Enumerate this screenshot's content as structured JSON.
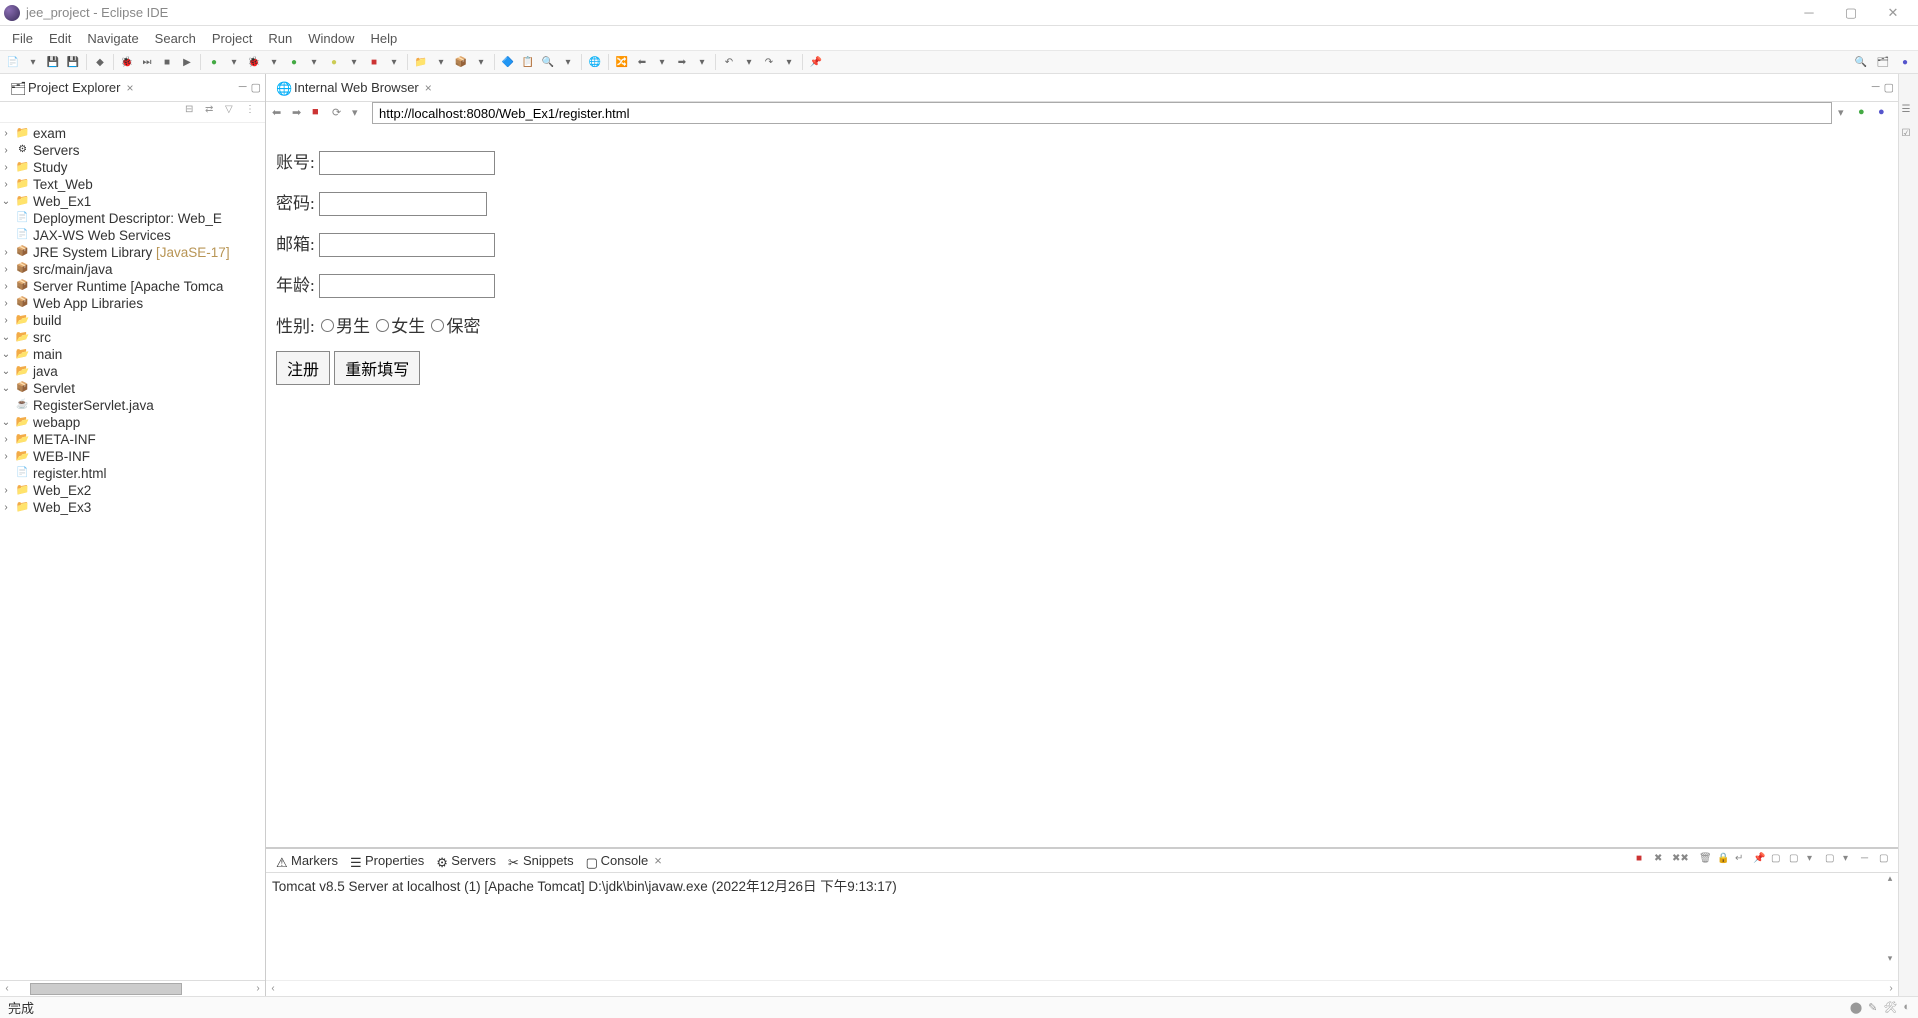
{
  "window": {
    "title": "jee_project - Eclipse IDE"
  },
  "menu": {
    "file": "File",
    "edit": "Edit",
    "navigate": "Navigate",
    "search": "Search",
    "project": "Project",
    "run": "Run",
    "window": "Window",
    "help": "Help"
  },
  "explorer": {
    "title": "Project Explorer",
    "projects": {
      "exam": "exam",
      "servers": "Servers",
      "study": "Study",
      "text_web": "Text_Web",
      "web_ex1": "Web_Ex1",
      "web_ex2": "Web_Ex2",
      "web_ex3": "Web_Ex3"
    },
    "web_ex1_children": {
      "dd": "Deployment Descriptor: Web_E",
      "jaxws": "JAX-WS Web Services",
      "jre": "JRE System Library ",
      "jre_suffix": "[JavaSE-17]",
      "src_main_java": "src/main/java",
      "server_runtime": "Server Runtime [Apache Tomca",
      "web_app_libs": "Web App Libraries",
      "build": "build",
      "src": "src",
      "main": "main",
      "java": "java",
      "servlet": "Servlet",
      "register_servlet": "RegisterServlet.java",
      "webapp": "webapp",
      "meta_inf": "META-INF",
      "web_inf": "WEB-INF",
      "register_html": "register.html"
    }
  },
  "browser": {
    "tab_title": "Internal Web Browser",
    "url": "http://localhost:8080/Web_Ex1/register.html",
    "form": {
      "account": "账号:",
      "password": "密码:",
      "email": "邮箱:",
      "age": "年龄:",
      "gender": "性别:",
      "male": "男生",
      "female": "女生",
      "secret": "保密",
      "register": "注册",
      "reset": "重新填写"
    }
  },
  "bottom": {
    "markers": "Markers",
    "properties": "Properties",
    "servers": "Servers",
    "snippets": "Snippets",
    "console": "Console",
    "console_line": "Tomcat v8.5 Server at localhost (1) [Apache Tomcat] D:\\jdk\\bin\\javaw.exe  (2022年12月26日 下午9:13:17)"
  },
  "status": {
    "text": "完成"
  }
}
